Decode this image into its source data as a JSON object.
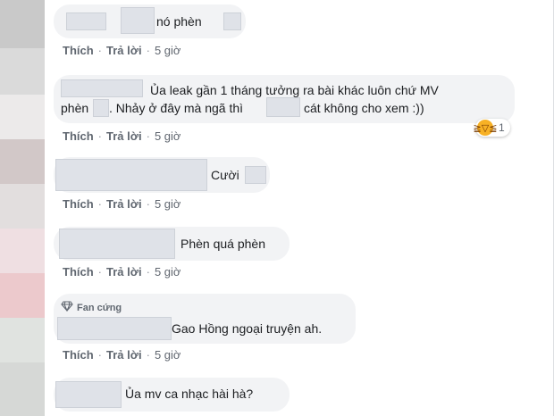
{
  "action_labels": {
    "like": "Thích",
    "reply": "Trả lời",
    "time": "5 giờ"
  },
  "badge": {
    "label": "Fan cứng",
    "icon": "diamond-icon"
  },
  "comments": [
    {
      "text": "nó phèn"
    },
    {
      "line1": "Ủa leak gần 1 tháng tưởng ra bài khác luôn chứ MV",
      "line2a": "phèn",
      "line2b": ". Nhảy ở đây mà ngã thì",
      "line2c": "cát không cho xem :))",
      "reaction_count": "1",
      "reaction_icon": "laughing-emoji-icon"
    },
    {
      "text": "Cười"
    },
    {
      "text": "Phèn quá phèn"
    },
    {
      "text": "Gao Hồng ngoại truyện ah."
    },
    {
      "text": "Ủa mv ca nhạc hài hà?"
    }
  ],
  "colors": {
    "bubble": "#f2f3f5",
    "meta": "#606770",
    "text": "#1c1e21"
  }
}
